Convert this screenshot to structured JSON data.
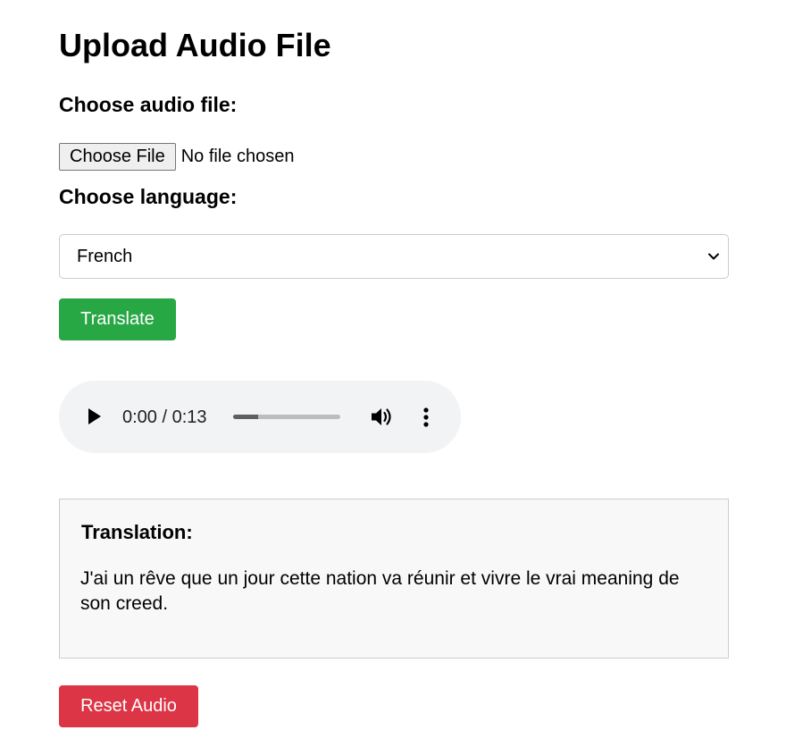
{
  "page": {
    "title": "Upload Audio File"
  },
  "file_input": {
    "label": "Choose audio file:",
    "button_label": "Choose File",
    "status": "No file chosen"
  },
  "language": {
    "label": "Choose language:",
    "selected": "French"
  },
  "translate_button": {
    "label": "Translate",
    "color": "#28a745"
  },
  "audio": {
    "time": "0:00 / 0:13",
    "progress_fraction": 0.23,
    "icons": [
      "play-icon",
      "volume-icon",
      "more-vert-icon"
    ]
  },
  "translation": {
    "heading": "Translation:",
    "text": "J'ai un rêve que un jour cette nation va réunir et vivre le vrai meaning de son creed."
  },
  "reset_button": {
    "label": "Reset Audio",
    "color": "#dc3545"
  }
}
